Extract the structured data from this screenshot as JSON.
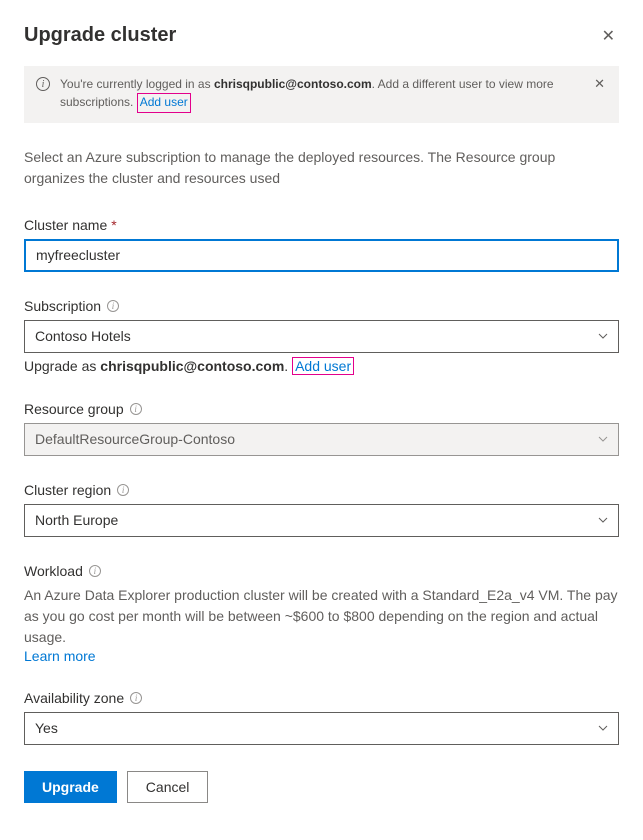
{
  "header": {
    "title": "Upgrade cluster"
  },
  "banner": {
    "prefix": "You're currently logged in as ",
    "email": "chrisqpublic@contoso.com",
    "suffix": ". Add a different user to view more subscriptions. ",
    "add_user": "Add user"
  },
  "description": "Select an Azure subscription to manage the deployed resources. The Resource group organizes the cluster and resources used",
  "cluster_name": {
    "label": "Cluster name",
    "value": "myfreecluster"
  },
  "subscription": {
    "label": "Subscription",
    "value": "Contoso Hotels",
    "helper_prefix": "Upgrade as ",
    "helper_email": "chrisqpublic@contoso.com",
    "helper_suffix": ". ",
    "add_user": "Add user"
  },
  "resource_group": {
    "label": "Resource group",
    "value": "DefaultResourceGroup-Contoso"
  },
  "cluster_region": {
    "label": "Cluster region",
    "value": "North Europe"
  },
  "workload": {
    "label": "Workload",
    "desc": "An Azure Data Explorer production cluster will be created with a Standard_E2a_v4 VM. The pay as you go cost per month will be between ~$600 to $800 depending on the region and actual usage.",
    "learn_more": "Learn more"
  },
  "availability_zone": {
    "label": "Availability zone",
    "value": "Yes"
  },
  "actions": {
    "upgrade": "Upgrade",
    "cancel": "Cancel"
  }
}
